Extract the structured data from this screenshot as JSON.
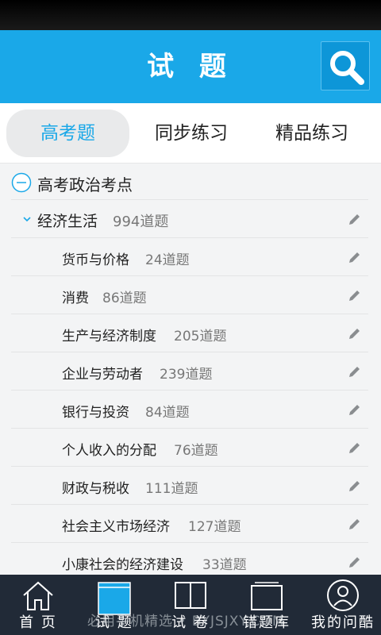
{
  "header": {
    "title": "试 题",
    "search_icon": "search-icon"
  },
  "tabs": [
    {
      "label": "高考题",
      "active": true
    },
    {
      "label": "同步练习",
      "active": false
    },
    {
      "label": "精品练习",
      "active": false
    }
  ],
  "tree": {
    "root": {
      "label": "高考政治考点",
      "icon": "collapse-minus-icon"
    },
    "group": {
      "label": "经济生活",
      "count": "994道题",
      "icon": "chevron-down-icon"
    },
    "items": [
      {
        "label": "货币与价格",
        "count": "24道题"
      },
      {
        "label": "消费",
        "count": "86道题"
      },
      {
        "label": "生产与经济制度",
        "count": "205道题"
      },
      {
        "label": "企业与劳动者",
        "count": "239道题"
      },
      {
        "label": "银行与投资",
        "count": "84道题"
      },
      {
        "label": "个人收入的分配",
        "count": "76道题"
      },
      {
        "label": "财政与税收",
        "count": "111道题"
      },
      {
        "label": "社会主义市场经济",
        "count": "127道题"
      },
      {
        "label": "小康社会的经济建设",
        "count": "33道题"
      }
    ]
  },
  "bottom_nav": [
    {
      "label": "首 页",
      "icon": "home-icon",
      "active": false
    },
    {
      "label": "试 题",
      "icon": "question-sheet-icon",
      "active": true
    },
    {
      "label": "试 卷",
      "icon": "book-icon",
      "active": false
    },
    {
      "label": "错题库",
      "icon": "folder-icon",
      "active": false
    },
    {
      "label": "我的问酷",
      "icon": "user-icon",
      "active": false
    }
  ],
  "watermark": "必用手机精选 • BYJSJXY.COM",
  "colors": {
    "accent": "#1aa8e8",
    "nav_bg": "#212a37",
    "header_bg": "#1aa8e8"
  }
}
